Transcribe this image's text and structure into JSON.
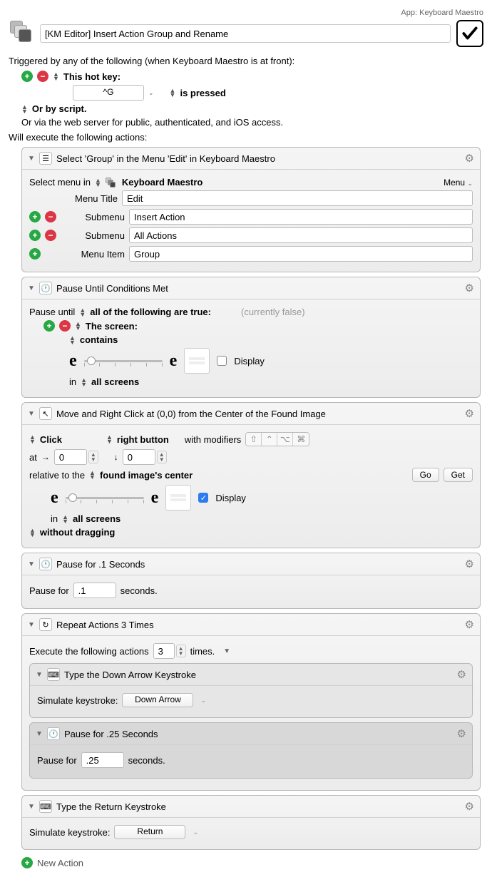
{
  "app_label": "App: Keyboard Maestro",
  "macro_title": "[KM Editor] Insert Action Group and Rename",
  "trigger_intro": "Triggered by any of the following (when Keyboard Maestro is at front):",
  "hotkey": {
    "label": "This hot key:",
    "key": "^G",
    "mode": "is pressed"
  },
  "or_script": "Or by script.",
  "or_web": "Or via the web server for public, authenticated, and iOS access.",
  "exec_intro": "Will execute the following actions:",
  "actions": {
    "select_menu": {
      "title": "Select 'Group' in the Menu 'Edit' in Keyboard Maestro",
      "select_in_label": "Select menu in",
      "app_name": "Keyboard Maestro",
      "menu_label": "Menu",
      "rows": {
        "menu_title_label": "Menu Title",
        "menu_title_value": "Edit",
        "submenu1_label": "Submenu",
        "submenu1_value": "Insert Action",
        "submenu2_label": "Submenu",
        "submenu2_value": "All Actions",
        "menu_item_label": "Menu Item",
        "menu_item_value": "Group"
      }
    },
    "pause_until": {
      "title": "Pause Until Conditions Met",
      "pause_label": "Pause until",
      "mode": "all of the following are true:",
      "status": "(currently false)",
      "screen_label": "The screen:",
      "contains": "contains",
      "display_label": "Display",
      "in_label": "in",
      "scope": "all screens"
    },
    "click": {
      "title": "Move and Right Click at (0,0) from the Center of the Found Image",
      "click_label": "Click",
      "button": "right button",
      "modifiers_label": "with modifiers",
      "at_label": "at",
      "x": "0",
      "y": "0",
      "relative_label": "relative to the",
      "relative_value": "found image's center",
      "go": "Go",
      "get": "Get",
      "display_label": "Display",
      "in_label": "in",
      "scope": "all screens",
      "drag": "without dragging"
    },
    "pause1": {
      "title": "Pause for .1 Seconds",
      "label": "Pause for",
      "value": ".1",
      "suffix": "seconds."
    },
    "repeat": {
      "title": "Repeat Actions 3 Times",
      "label": "Execute the following actions",
      "count": "3",
      "suffix": "times.",
      "child_down": {
        "title": "Type the Down Arrow Keystroke",
        "label": "Simulate keystroke:",
        "key": "Down Arrow"
      },
      "child_pause": {
        "title": "Pause for .25 Seconds",
        "label": "Pause for",
        "value": ".25",
        "suffix": "seconds."
      }
    },
    "return": {
      "title": "Type the Return Keystroke",
      "label": "Simulate keystroke:",
      "key": "Return"
    }
  },
  "new_action": "New Action"
}
